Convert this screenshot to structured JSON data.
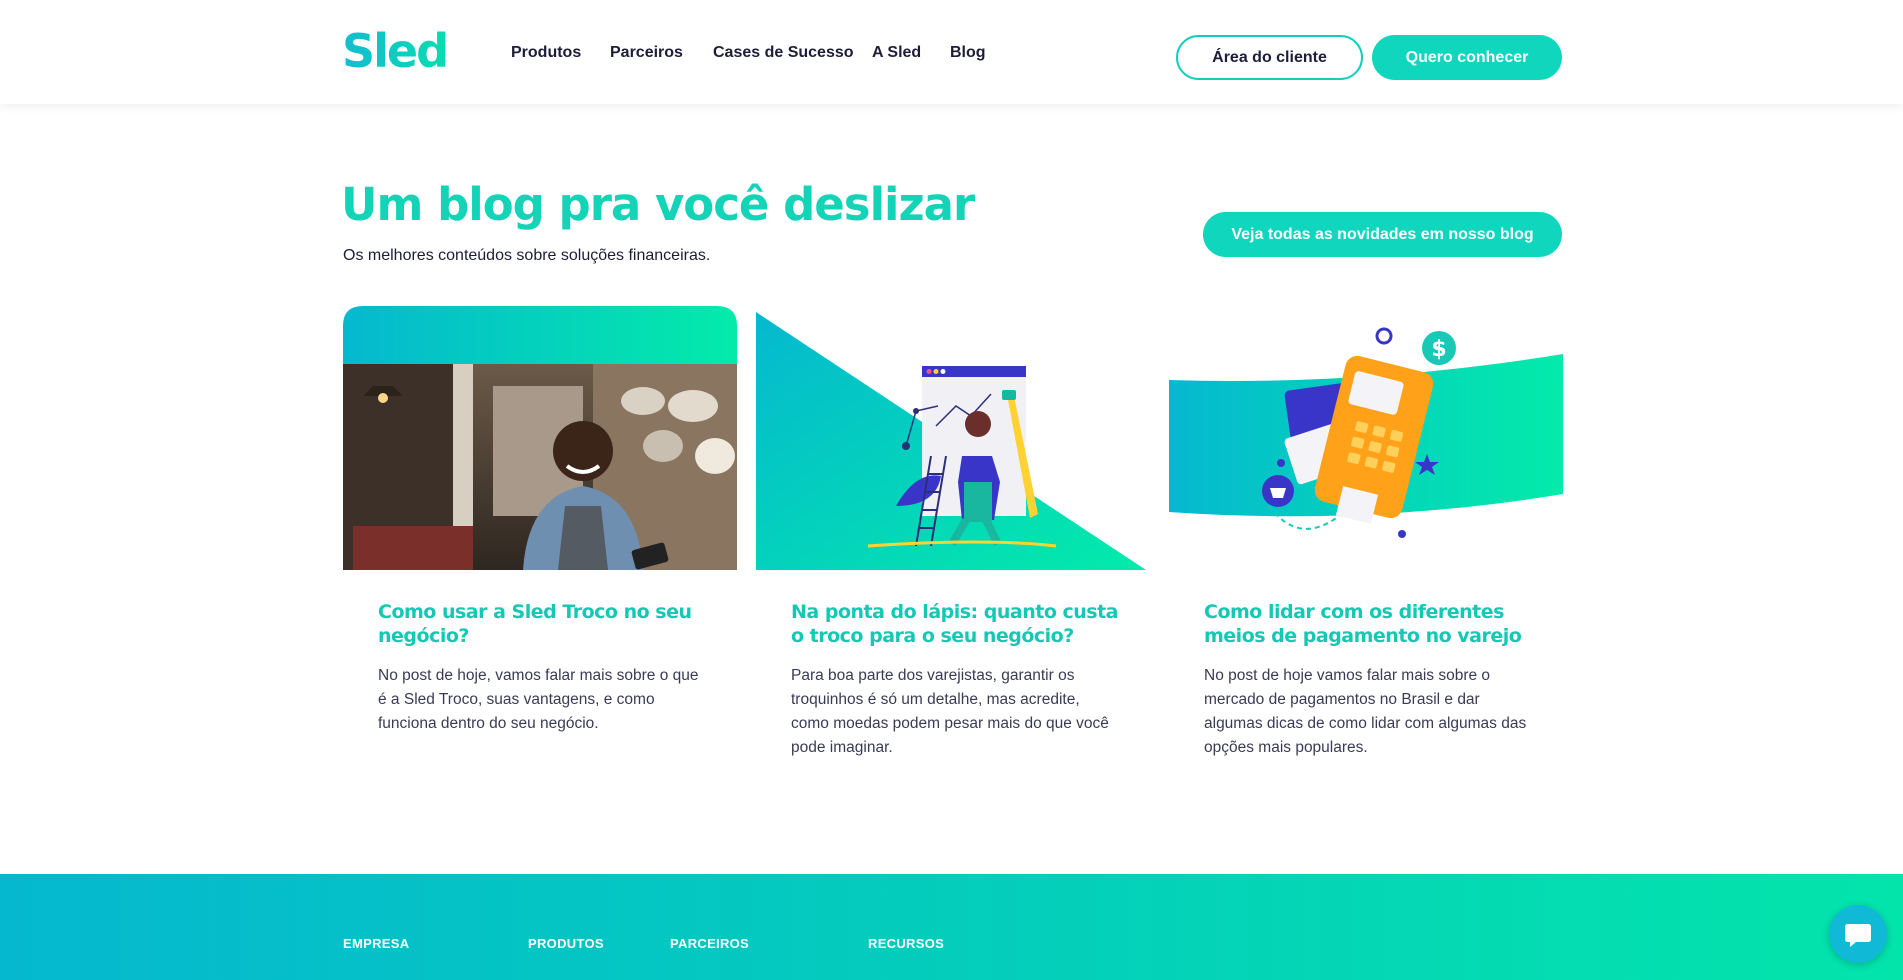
{
  "header": {
    "logo": "Sled",
    "nav": [
      "Produtos",
      "Parceiros",
      "Cases de Sucesso",
      "A Sled",
      "Blog"
    ],
    "client_area": "Área do cliente",
    "cta": "Quero conhecer"
  },
  "section": {
    "title": "Um blog pra você deslizar",
    "subtitle": "Os melhores conteúdos sobre soluções financeiras.",
    "button": "Veja todas as novidades em nosso blog"
  },
  "cards": [
    {
      "title": "Como usar a Sled Troco no seu negócio?",
      "text": "No post de hoje, vamos falar mais sobre o que é a Sled Troco, suas vantagens, e como funciona dentro do seu negócio."
    },
    {
      "title": "Na ponta do lápis: quanto custa o troco para o seu negócio?",
      "text": "Para boa parte dos varejistas, garantir os troquinhos é só um detalhe, mas acredite, como moedas podem pesar mais do que você pode imaginar."
    },
    {
      "title": "Como lidar com os diferentes meios de pagamento no varejo",
      "text": "No post de hoje vamos falar mais sobre o mercado de pagamentos no Brasil e dar algumas dicas de como lidar com algumas das opções mais populares."
    }
  ],
  "footer": {
    "columns": [
      "EMPRESA",
      "PRODUTOS",
      "PARCEIROS",
      "RECURSOS"
    ]
  },
  "colors": {
    "accent": "#10d6bd",
    "title": "#14d4b8",
    "dark_text": "#1d1d3a",
    "gradient_start": "#05b8cf",
    "gradient_end": "#03e4ab"
  }
}
